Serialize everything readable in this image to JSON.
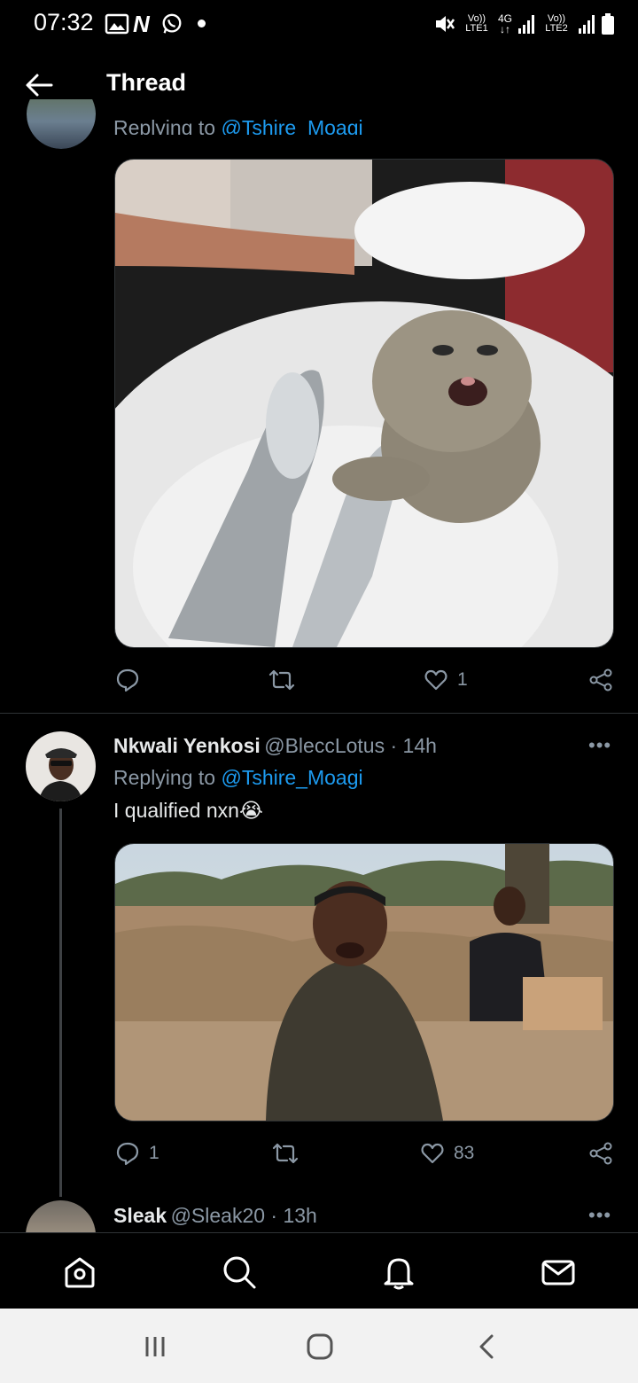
{
  "status_bar": {
    "time": "07:32",
    "network_1": "Vo)) LTE1",
    "network_type": "4G",
    "network_2": "Vo)) LTE2"
  },
  "header": {
    "title": "Thread"
  },
  "tweet_top": {
    "replying_to_label": "Replying to ",
    "replying_to_user": "@Tshire_Moagi",
    "actions": {
      "like_count": "1"
    }
  },
  "tweet_2": {
    "name": "Nkwali Yenkosi",
    "handle_time": "@BleccLotus · 14h",
    "replying_to_label": "Replying to ",
    "replying_to_user": "@Tshire_Moagi",
    "text": "I qualified nxn",
    "emoji": "😭",
    "actions": {
      "reply_count": "1",
      "like_count": "83"
    }
  },
  "tweet_3": {
    "name": "Sleak",
    "handle_time": "@Sleak20 · 13h"
  },
  "colors": {
    "link": "#1d9bf0",
    "muted": "#8b98a5",
    "background": "#000000"
  },
  "bottom_nav": [
    "home-icon",
    "search-icon",
    "notifications-icon",
    "messages-icon"
  ]
}
